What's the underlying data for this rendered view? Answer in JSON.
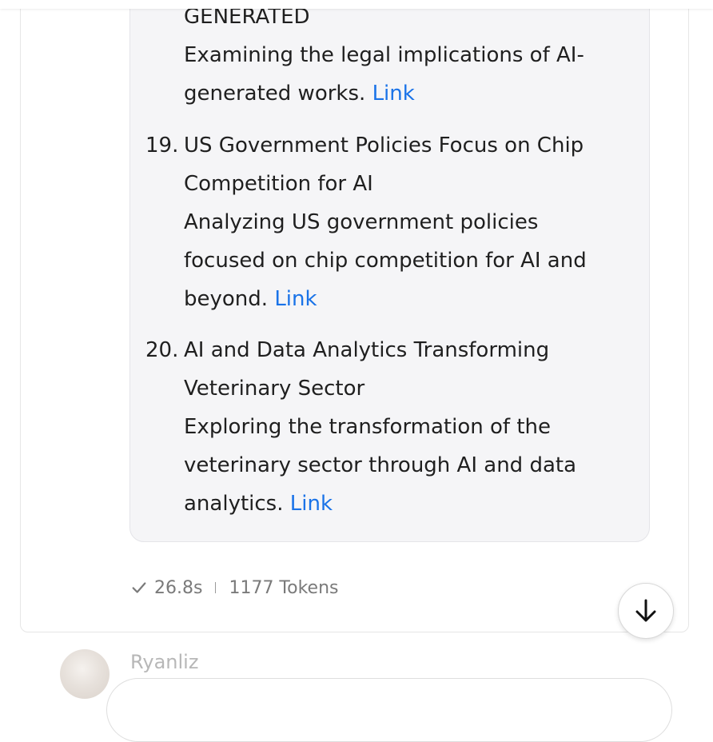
{
  "items": [
    {
      "number": "",
      "title_lines": [
        "GENERATED"
      ],
      "desc_lines": [
        "Examining the legal implications of AI-",
        "generated works."
      ],
      "link_label": "Link"
    },
    {
      "number": "19.",
      "title_lines": [
        "US Government Policies Focus on Chip",
        "Competition for AI"
      ],
      "desc_lines": [
        "Analyzing US government policies",
        "focused on chip competition for AI and",
        "beyond."
      ],
      "link_label": "Link"
    },
    {
      "number": "20.",
      "title_lines": [
        "AI and Data Analytics Transforming",
        "Veterinary Sector"
      ],
      "desc_lines": [
        "Exploring the transformation of the",
        "veterinary sector through AI and data",
        "analytics."
      ],
      "link_label": "Link"
    }
  ],
  "meta": {
    "duration": "26.8s",
    "tokens": "1177 Tokens"
  },
  "next_message": {
    "username": "Ryanliz"
  },
  "icons": {
    "check": "check-icon",
    "scroll": "arrow-down-icon"
  },
  "colors": {
    "link": "#1a73e8",
    "content_bg": "#f5f5f7"
  }
}
